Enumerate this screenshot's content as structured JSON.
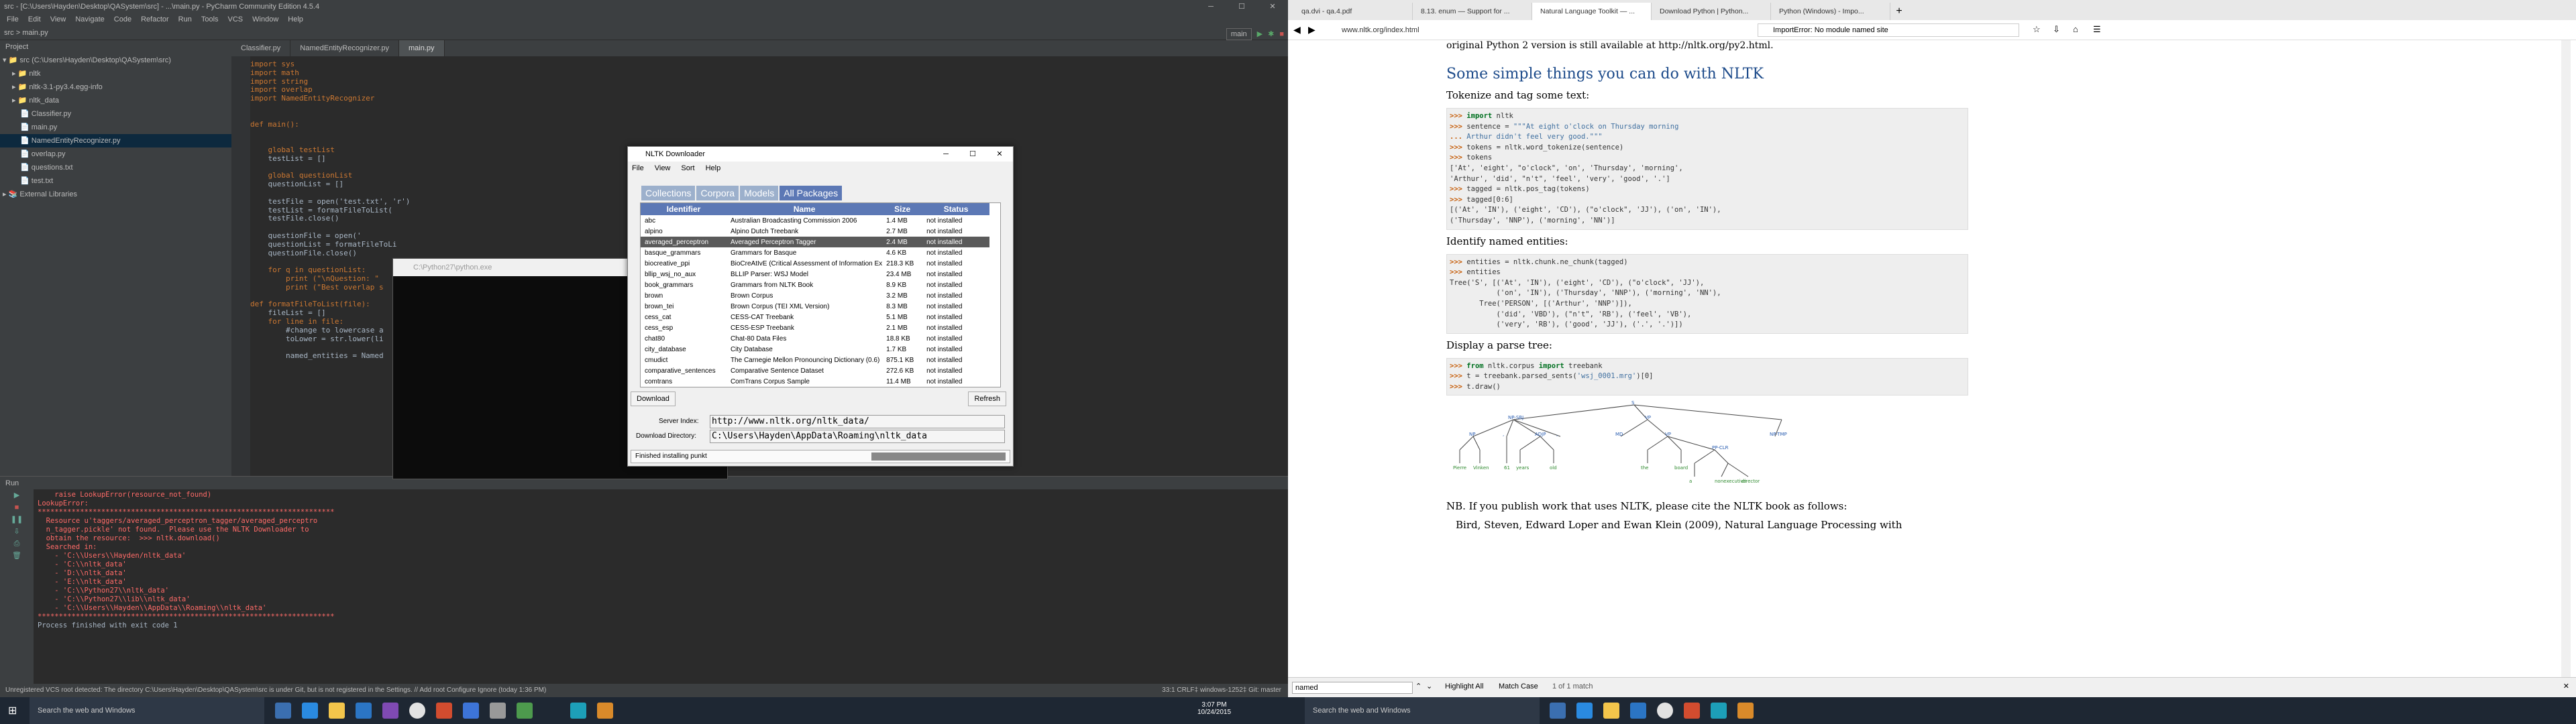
{
  "ide": {
    "title": "src - [C:\\Users\\Hayden\\Desktop\\QASystem\\src] - ...\\main.py - PyCharm Community Edition 4.5.4",
    "menu": [
      "File",
      "Edit",
      "View",
      "Navigate",
      "Code",
      "Refactor",
      "Run",
      "Tools",
      "VCS",
      "Window",
      "Help"
    ],
    "breadcrumb": "src  >  main.py",
    "run_config": "main",
    "project_label": "Project",
    "tree": [
      "src (C:\\Users\\Hayden\\Desktop\\QASystem\\src)",
      "nltk",
      "nltk-3.1-py3.4.egg-info",
      "nltk_data",
      "Classifier.py",
      "main.py",
      "NamedEntityRecognizer.py",
      "overlap.py",
      "questions.txt",
      "test.txt",
      "External Libraries"
    ],
    "tabs": [
      "Classifier.py",
      "NamedEntityRecognizer.py",
      "main.py"
    ],
    "code": [
      "import sys",
      "import math",
      "import string",
      "import overlap",
      "import NamedEntityRecognizer",
      "",
      "",
      "def main():",
      "",
      "",
      "    global testList",
      "    testList = []",
      "",
      "    global questionList",
      "    questionList = []",
      "",
      "    testFile = open('test.txt', 'r')",
      "    testList = formatFileToList(",
      "    testFile.close()",
      "",
      "    questionFile = open('",
      "    questionList = formatFileToLi",
      "    questionFile.close()",
      "",
      "    for q in questionList:",
      "        print (\"\\nQuestion: \"",
      "        print (\"Best overlap s",
      "",
      "def formatFileToList(file):",
      "    fileList = []",
      "    for line in file:",
      "        #change to lowercase a",
      "        toLower = str.lower(li",
      "",
      "        named_entities = Named"
    ],
    "run_label": "Run",
    "console": [
      "    raise LookupError(resource_not_found)",
      "LookupError:",
      "**********************************************************************",
      "  Resource u'taggers/averaged_perceptron_tagger/averaged_perceptro",
      "  n_tagger.pickle' not found.  Please use the NLTK Downloader to",
      "  obtain the resource:  >>> nltk.download()",
      "  Searched in:",
      "    - 'C:\\\\Users\\\\Hayden/nltk_data'",
      "    - 'C:\\\\nltk_data'",
      "    - 'D:\\\\nltk_data'",
      "    - 'E:\\\\nltk_data'",
      "    - 'C:\\\\Python27\\\\nltk_data'",
      "    - 'C:\\\\Python27\\\\lib\\\\nltk_data'",
      "    - 'C:\\\\Users\\\\Hayden\\\\AppData\\\\Roaming\\\\nltk_data'",
      "**********************************************************************",
      "",
      "",
      "Process finished with exit code 1"
    ],
    "status_left": "Unregistered VCS root detected: The directory C:\\Users\\Hayden\\Desktop\\QASystem\\src is under Git, but is not registered in the Settings. // Add root  Configure  Ignore (today 1:36 PM)",
    "status_right": "33:1  CRLF‡  windows-1252‡  Git: master"
  },
  "pyconsole": {
    "title": "C:\\Python27\\python.exe"
  },
  "nltk": {
    "title": "NLTK Downloader",
    "menu": [
      "File",
      "View",
      "Sort",
      "Help"
    ],
    "tabs": [
      "Collections",
      "Corpora",
      "Models",
      "All Packages"
    ],
    "headers": [
      "Identifier",
      "Name",
      "Size",
      "Status"
    ],
    "rows": [
      [
        "abc",
        "Australian Broadcasting Commission 2006",
        "1.4 MB",
        "not installed"
      ],
      [
        "alpino",
        "Alpino Dutch Treebank",
        "2.7 MB",
        "not installed"
      ],
      [
        "averaged_perceptron",
        "Averaged Perceptron Tagger",
        "2.4 MB",
        "not installed"
      ],
      [
        "basque_grammars",
        "Grammars for Basque",
        "4.6 KB",
        "not installed"
      ],
      [
        "biocreative_ppi",
        "BioCreAtIvE (Critical Assessment of Information Ex",
        "218.3 KB",
        "not installed"
      ],
      [
        "bllip_wsj_no_aux",
        "BLLIP Parser: WSJ Model",
        "23.4 MB",
        "not installed"
      ],
      [
        "book_grammars",
        "Grammars from NLTK Book",
        "8.9 KB",
        "not installed"
      ],
      [
        "brown",
        "Brown Corpus",
        "3.2 MB",
        "not installed"
      ],
      [
        "brown_tei",
        "Brown Corpus (TEI XML Version)",
        "8.3 MB",
        "not installed"
      ],
      [
        "cess_cat",
        "CESS-CAT Treebank",
        "5.1 MB",
        "not installed"
      ],
      [
        "cess_esp",
        "CESS-ESP Treebank",
        "2.1 MB",
        "not installed"
      ],
      [
        "chat80",
        "Chat-80 Data Files",
        "18.8 KB",
        "not installed"
      ],
      [
        "city_database",
        "City Database",
        "1.7 KB",
        "not installed"
      ],
      [
        "cmudict",
        "The Carnegie Mellon Pronouncing Dictionary (0.6)",
        "875.1 KB",
        "not installed"
      ],
      [
        "comparative_sentences",
        "Comparative Sentence Dataset",
        "272.6 KB",
        "not installed"
      ],
      [
        "comtrans",
        "ComTrans Corpus Sample",
        "11.4 MB",
        "not installed"
      ]
    ],
    "download_label": "Download",
    "refresh_label": "Refresh",
    "server_label": "Server Index:",
    "server_value": "http://www.nltk.org/nltk_data/",
    "dir_label": "Download Directory:",
    "dir_value": "C:\\Users\\Hayden\\AppData\\Roaming\\nltk_data",
    "status": "Finished installing punkt"
  },
  "browser": {
    "tabs": [
      "qa.dvi - qa.4.pdf",
      "8.13. enum — Support for ...",
      "Natural Language Toolkit — ...",
      "Download Python | Python...",
      "Python (Windows) - Impo..."
    ],
    "url": "www.nltk.org/index.html",
    "search": "ImportError: No module named site",
    "top_line": "original Python 2 version is still available at http://nltk.org/py2.html.",
    "heading": "Some simple things you can do with NLTK",
    "p1": "Tokenize and tag some text:",
    "p2": "Identify named entities:",
    "p3": "Display a parse tree:",
    "p4": "NB. If you publish work that uses NLTK, please cite the NLTK book as follows:",
    "p5": "Bird, Steven, Edward Loper and Ewan Klein (2009), Natural Language Processing with",
    "find_value": "named",
    "find_highlight": "Highlight All",
    "find_match": "Match Case",
    "find_count": "1 of 1 match"
  },
  "taskbar": {
    "search": "Search the web and Windows",
    "time": "3:07 PM",
    "date": "10/24/2015"
  }
}
